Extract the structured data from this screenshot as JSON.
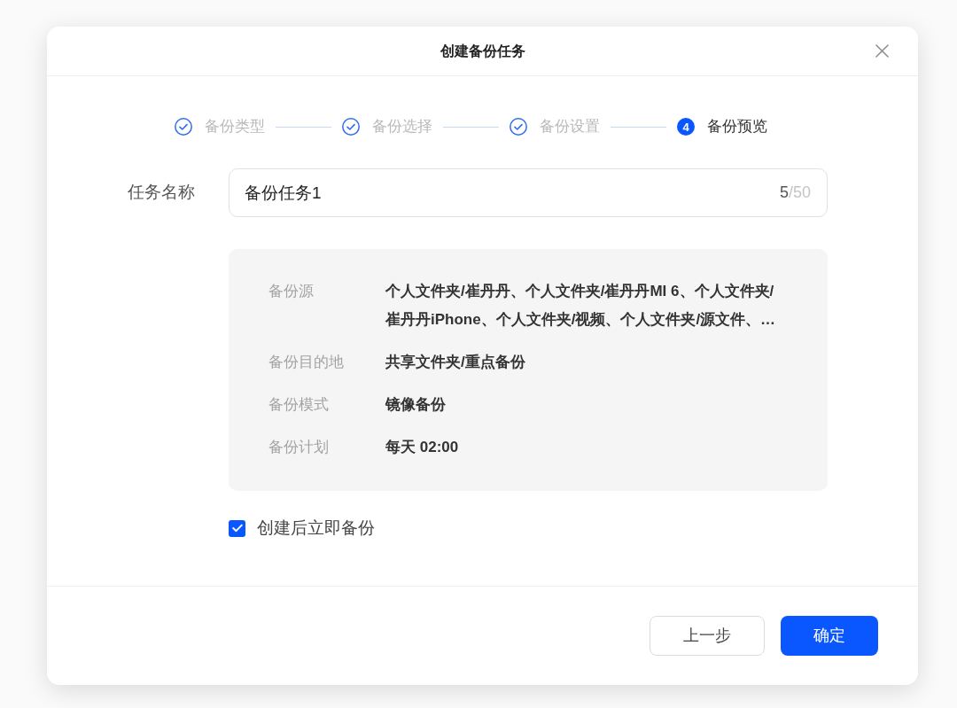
{
  "dialog": {
    "title": "创建备份任务"
  },
  "steps": [
    {
      "label": "备份类型",
      "kind": "done"
    },
    {
      "label": "备份选择",
      "kind": "done"
    },
    {
      "label": "备份设置",
      "kind": "done"
    },
    {
      "label": "备份预览",
      "kind": "current",
      "number": "4"
    }
  ],
  "task_name": {
    "label": "任务名称",
    "value": "备份任务1",
    "count": "5",
    "limit": "/50"
  },
  "summary": {
    "rows": [
      {
        "label": "备份源",
        "value": "个人文件夹/崔丹丹、个人文件夹/崔丹丹MI 6、个人文件夹/崔丹丹iPhone、个人文件夹/视频、个人文件夹/源文件、…"
      },
      {
        "label": "备份目的地",
        "value": "共享文件夹/重点备份"
      },
      {
        "label": "备份模式",
        "value": "镜像备份"
      },
      {
        "label": "备份计划",
        "value": "每天 02:00"
      }
    ]
  },
  "backup_now": {
    "label": "创建后立即备份",
    "checked": true
  },
  "buttons": [
    {
      "label": "上一步",
      "kind": "secondary"
    },
    {
      "label": "确定",
      "kind": "primary"
    }
  ]
}
